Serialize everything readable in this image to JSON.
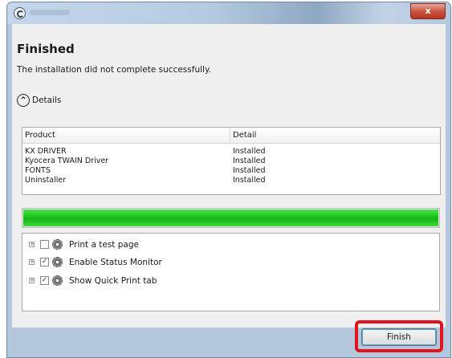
{
  "window": {
    "close_glyph": "x"
  },
  "page": {
    "heading": "Finished",
    "subtitle": "The installation did not complete successfully.",
    "details_label": "Details"
  },
  "table": {
    "columns": [
      "Product",
      "Detail"
    ],
    "rows": [
      [
        "KX DRIVER",
        "Installed"
      ],
      [
        "Kyocera TWAIN Driver",
        "Installed"
      ],
      [
        "FONTS",
        "Installed"
      ],
      [
        "Uninstaller",
        "Installed"
      ]
    ]
  },
  "progress": {
    "value": 1.0,
    "color": "#18c418"
  },
  "options": [
    {
      "label": "Print a test page",
      "checked": false
    },
    {
      "label": "Enable Status Monitor",
      "checked": true
    },
    {
      "label": "Show Quick Print tab",
      "checked": true
    }
  ],
  "footer": {
    "finish_label": "Finish",
    "highlight_color": "#e0121b"
  }
}
